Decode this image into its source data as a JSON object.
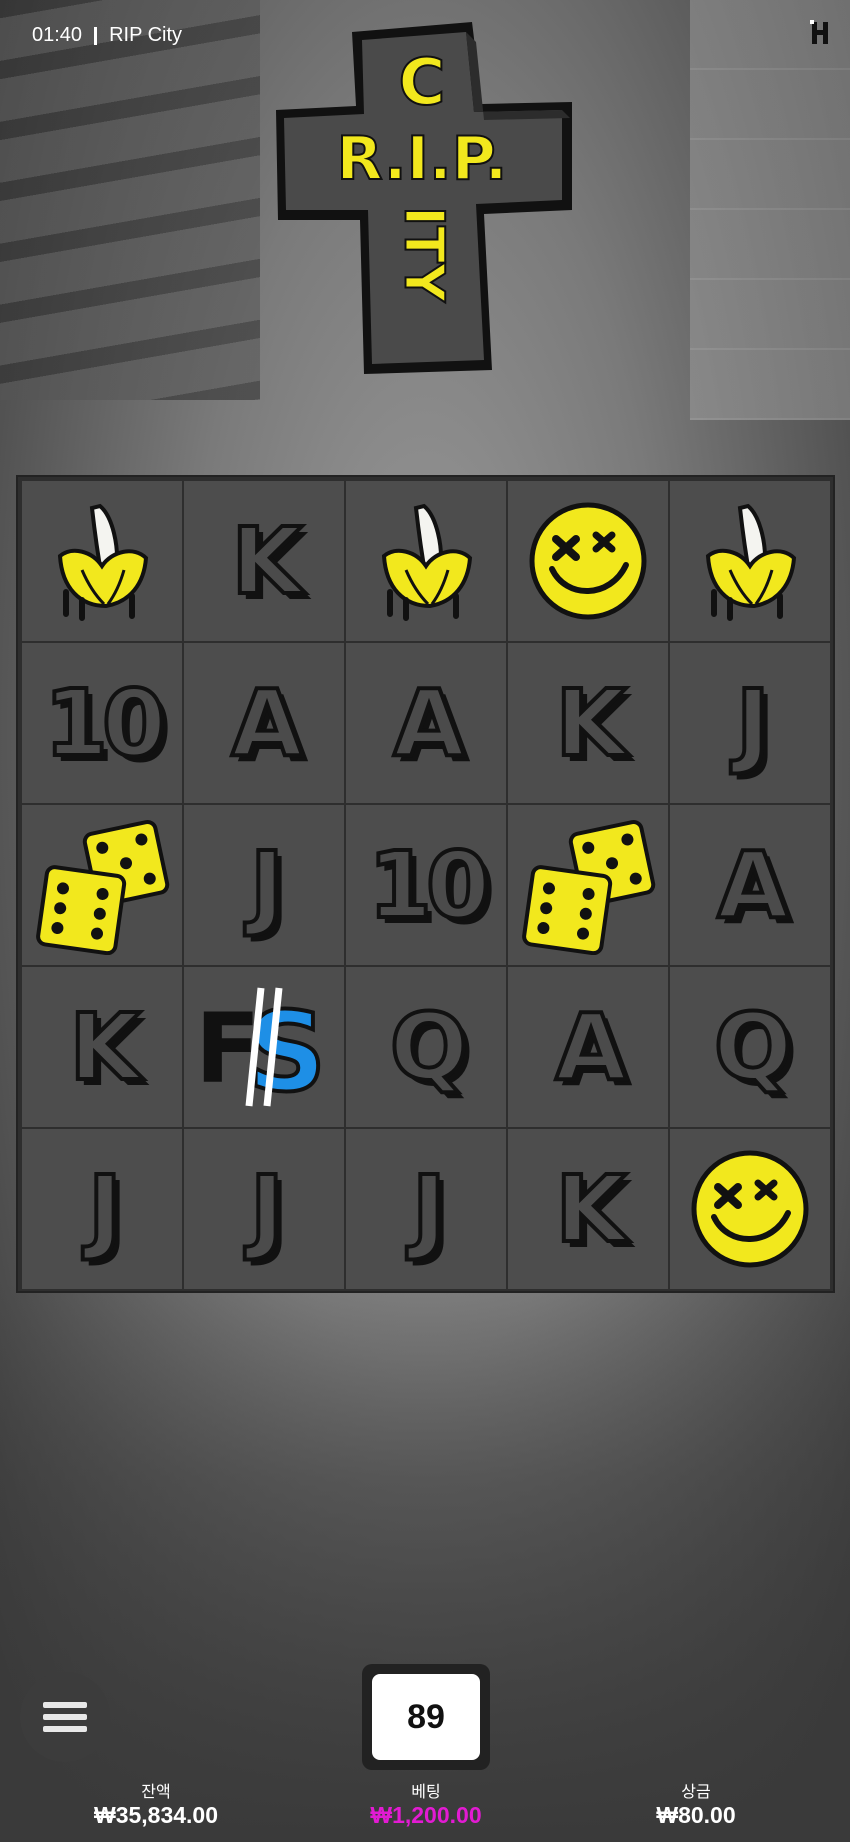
{
  "status": {
    "time": "01:40",
    "game_name": "RIP City"
  },
  "logo": {
    "line1": "C",
    "line2": "R.I.P.",
    "line3": "ITY"
  },
  "reels": [
    [
      "banana",
      "K",
      "banana",
      "smiley",
      "banana"
    ],
    [
      "10",
      "A",
      "A",
      "K",
      "J"
    ],
    [
      "dice",
      "J",
      "10",
      "dice",
      "A"
    ],
    [
      "K",
      "FS",
      "Q",
      "A",
      "Q"
    ],
    [
      "J",
      "J",
      "J",
      "K",
      "smiley"
    ]
  ],
  "spin_counter": "89",
  "footer": {
    "balance_label": "잔액",
    "balance_value": "₩35,834.00",
    "bet_label": "베팅",
    "bet_value": "₩1,200.00",
    "win_label": "상금",
    "win_value": "₩80.00"
  },
  "colors": {
    "accent_yellow": "#f2e81d",
    "bet_magenta": "#e21bd2",
    "fs_blue": "#1e8fe6"
  }
}
